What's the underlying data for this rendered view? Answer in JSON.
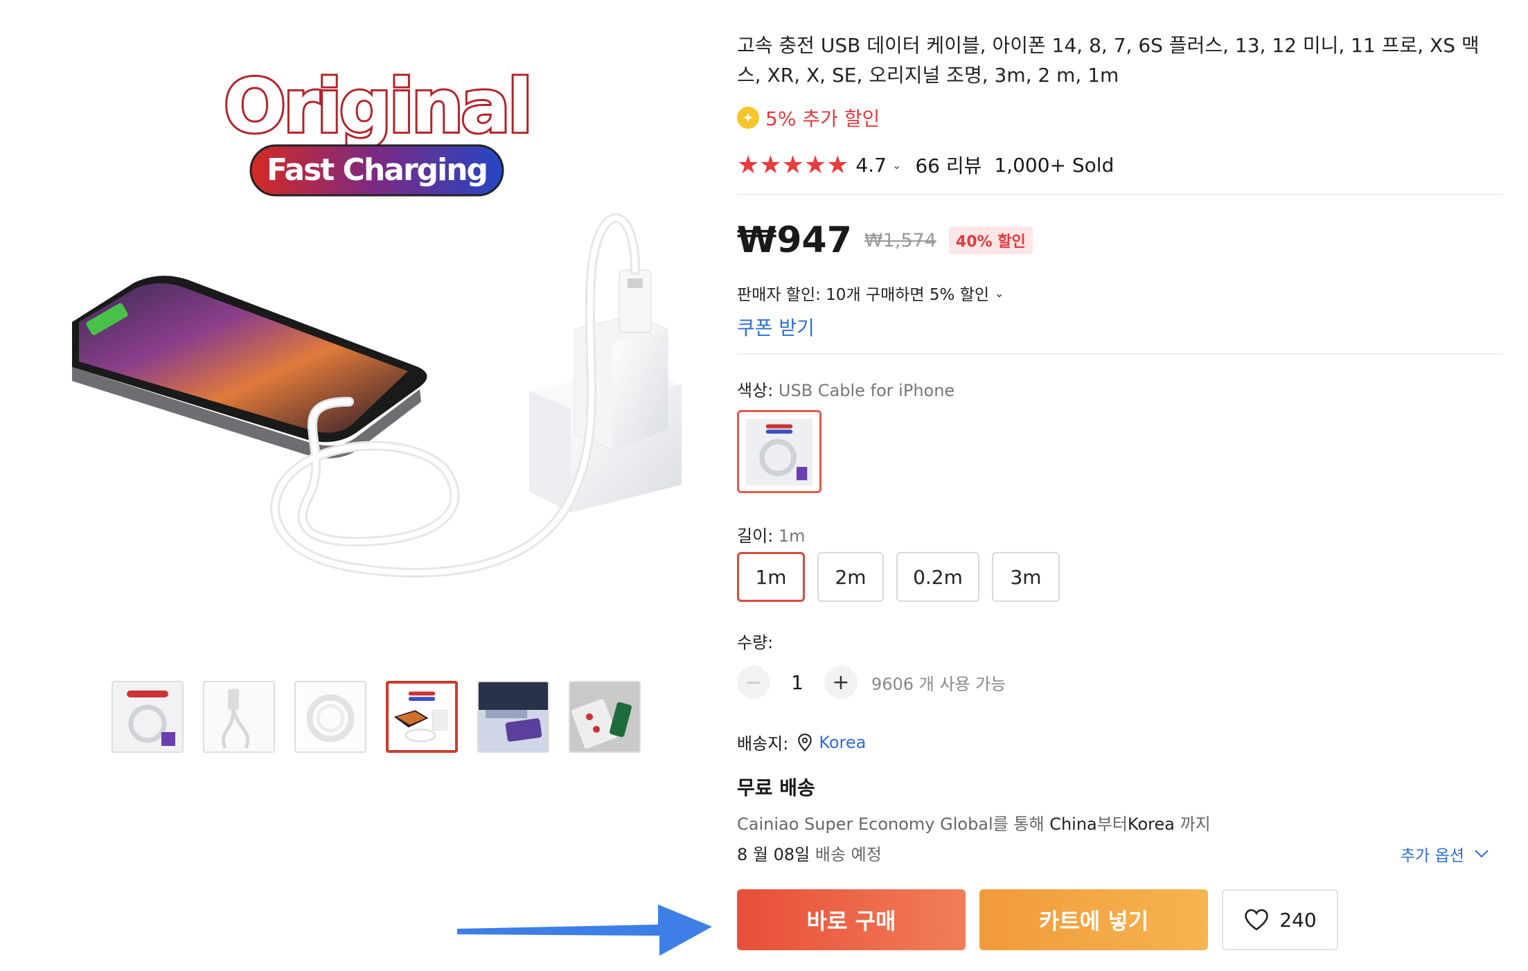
{
  "product": {
    "title": "고속 충전 USB 데이터 케이블, 아이폰 14, 8, 7, 6S 플러스, 13, 12 미니, 11 프로, XS 맥스, XR, X, SE, 오리지널 조명, 3m, 2 m, 1m",
    "promo_text": "5% 추가 할인",
    "rating": "4.7",
    "reviews": "66 리뷰",
    "sold": "1,000+ Sold"
  },
  "hero": {
    "logo_line1": "Original",
    "logo_line2": "Fast Charging"
  },
  "gallery": {
    "thumbnails": [
      {
        "name": "thumb-1",
        "active": false
      },
      {
        "name": "thumb-2",
        "active": false
      },
      {
        "name": "thumb-3",
        "active": false
      },
      {
        "name": "thumb-4",
        "active": true
      },
      {
        "name": "thumb-5",
        "active": false
      },
      {
        "name": "thumb-6",
        "active": false
      }
    ]
  },
  "price": {
    "current": "₩947",
    "original": "₩1,574",
    "discount": "40% 할인"
  },
  "seller_discount": "판매자 할인: 10개 구매하면 5% 할인",
  "coupon_label": "쿠폰 받기",
  "color": {
    "label": "색상:",
    "value": "USB Cable for iPhone"
  },
  "length": {
    "label": "길이:",
    "value": "1m",
    "options": [
      "1m",
      "2m",
      "0.2m",
      "3m"
    ],
    "selected_index": 0
  },
  "quantity": {
    "label": "수량:",
    "value": "1",
    "minus": "−",
    "plus": "+",
    "available": "9606 개 사용 가능"
  },
  "shipping": {
    "label": "배송지:",
    "location": "Korea",
    "free_label": "무료 배송",
    "via_pre": "Cainiao Super Economy Global를 통해 ",
    "from": "China",
    "mid": "부터",
    "to": "Korea",
    "post": " 까지",
    "eta_date": "8 월 08일",
    "eta_suffix": " 배송 예정",
    "more_options": "추가 옵션"
  },
  "actions": {
    "buy_now": "바로 구매",
    "add_to_cart": "카트에 넣기",
    "wishlist_count": "240"
  },
  "colors": {
    "accent_red": "#e0393e",
    "link_blue": "#2e6fd1",
    "buy_gradient": [
      "#e84e3a",
      "#f07e58"
    ],
    "cart_gradient": [
      "#f29a3b",
      "#f5b450"
    ],
    "arrow_blue": "#3d7fe6"
  },
  "icons": [
    "coin-icon",
    "star-icon",
    "chevron-down-icon",
    "location-pin-icon",
    "heart-icon",
    "arrow-right-icon"
  ]
}
